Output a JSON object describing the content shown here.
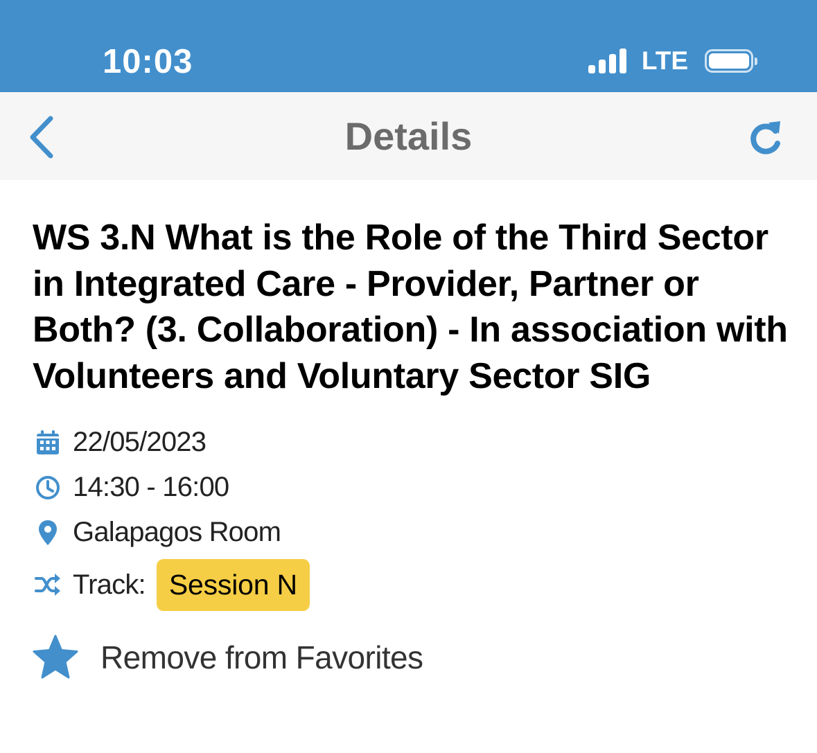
{
  "status_bar": {
    "time": "10:03",
    "network": "LTE",
    "signal_bars": 4,
    "battery_level": 1.0,
    "background_color": "#428FCC"
  },
  "nav": {
    "title": "Details",
    "back_icon": "chevron-left-icon",
    "refresh_icon": "refresh-icon",
    "accent_color": "#428FCC"
  },
  "session": {
    "title": "WS 3.N What is the Role of the Third Sector in Integrated Care - Provider, Partner or Both? (3. Collaboration) - In association with Volunteers and Voluntary Sector SIG",
    "date": "22/05/2023",
    "time": "14:30 - 16:00",
    "room": "Galapagos Room",
    "track_label": "Track:",
    "track_value": "Session N",
    "track_color": "#F5CE45"
  },
  "favorites": {
    "label": "Remove from Favorites",
    "icon": "star-icon"
  }
}
